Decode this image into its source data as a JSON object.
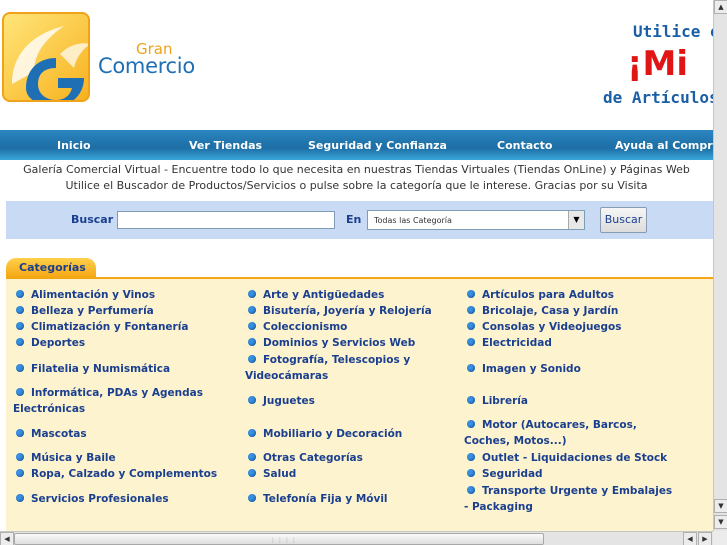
{
  "brand": {
    "gran": "Gran",
    "comercio": "Comercio"
  },
  "promo": {
    "line1": "Utilice el",
    "line2": "¡Mi",
    "line3": "de Artículos"
  },
  "nav": [
    "Inicio",
    "Ver Tiendas",
    "Seguridad y Confianza",
    "Contacto",
    "Ayuda al Compra"
  ],
  "intro": {
    "line1": "Galería Comercial Virtual - Encuentre todo lo que necesita en nuestras Tiendas Virtuales (Tiendas OnLine) y Páginas Web",
    "line2": "Utilice el Buscador de Productos/Servicios o pulse sobre la categoría que le interese. Gracias por su Visita"
  },
  "search": {
    "label": "Buscar",
    "value": "",
    "en_label": "En",
    "select_value": "Todas las Categoría",
    "button": "Buscar"
  },
  "categories_title": "Categorías",
  "categories": {
    "col1": [
      "Alimentación y Vinos",
      "Belleza y Perfumería",
      "Climatización y Fontanería",
      "Deportes",
      "Filatelia y Numismática",
      "Informática, PDAs y Agendas Electrónicas",
      "Mascotas",
      "Música y Baile",
      "Ropa, Calzado y Complementos",
      "Servicios Profesionales"
    ],
    "col2": [
      "Arte y Antigüedades",
      "Bisutería, Joyería y Relojería",
      "Coleccionismo",
      "Dominios y Servicios Web",
      "Fotografía, Telescopios y Videocámaras",
      "Juguetes",
      "Mobiliario y Decoración",
      "Otras Categorías",
      "Salud",
      "Telefonía Fija y Móvil"
    ],
    "col3": [
      "Artículos para Adultos",
      "Bricolaje, Casa y Jardín",
      "Consolas y Videojuegos",
      "Electricidad",
      "Imagen y Sonido",
      "Librería",
      "Motor (Autocares, Barcos, Coches, Motos...)",
      "Outlet - Liquidaciones de Stock",
      "Seguridad",
      "Transporte Urgente y Embalajes - Packaging"
    ]
  }
}
